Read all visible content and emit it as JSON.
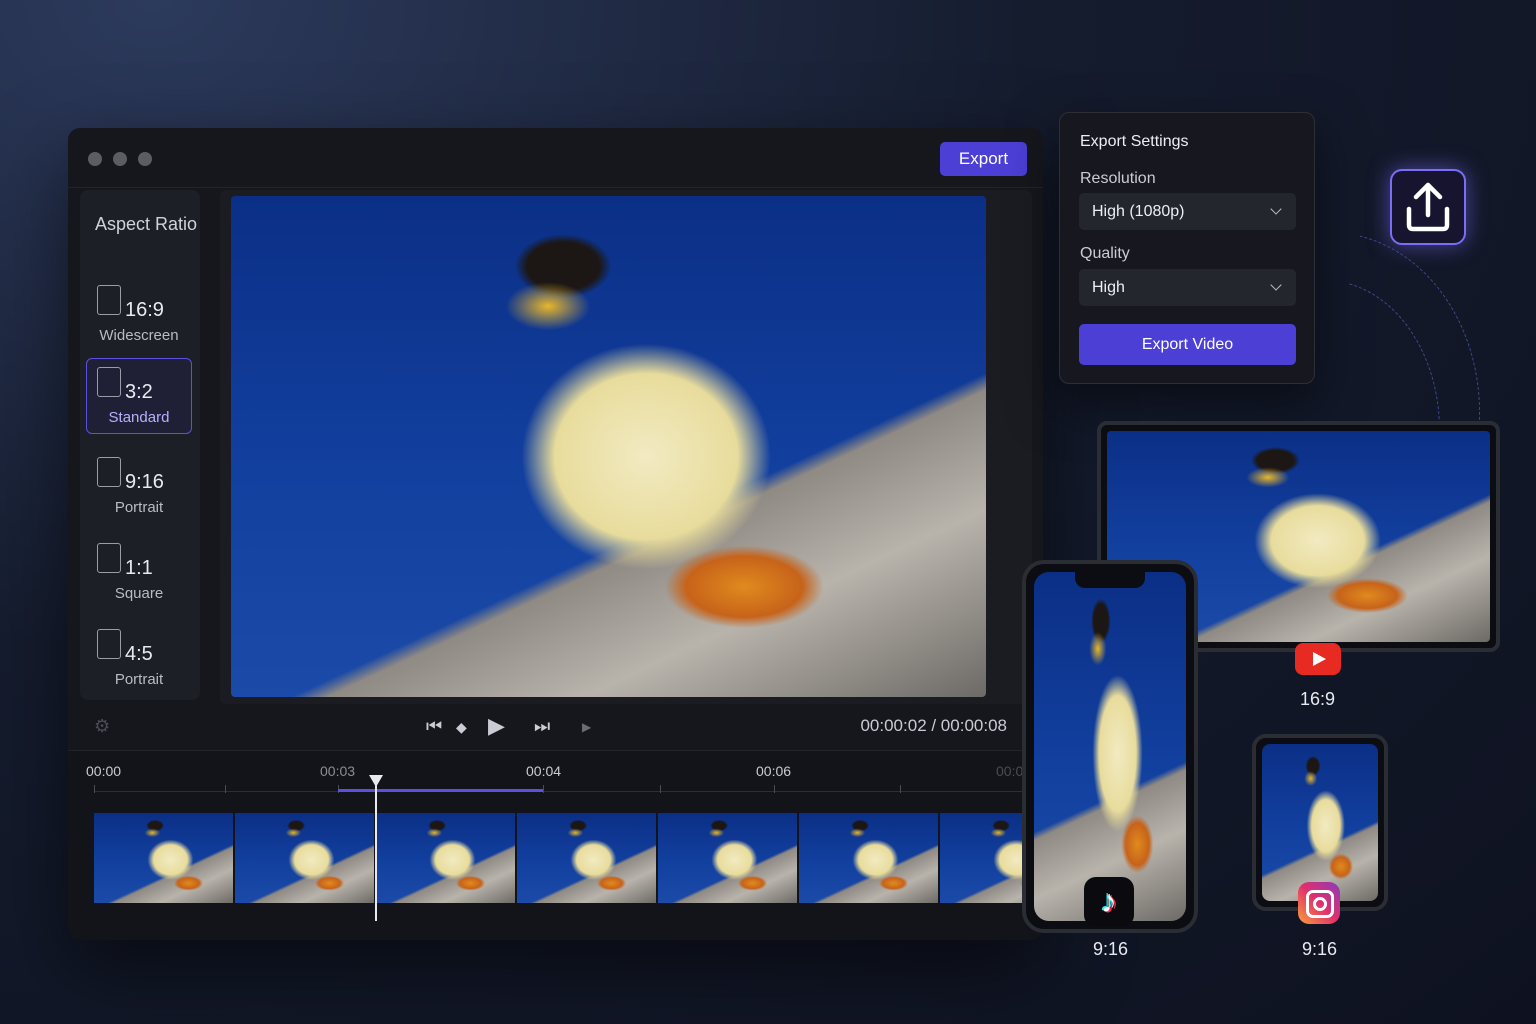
{
  "editor": {
    "export_label": "Export",
    "sidebar": {
      "title": "Aspect Ratio",
      "ratios": [
        {
          "value": "16:9",
          "label": "Widescreen"
        },
        {
          "value": "3:2",
          "label": "Standard",
          "selected": true
        },
        {
          "value": "9:16",
          "label": "Portrait"
        },
        {
          "value": "1:1",
          "label": "Square"
        },
        {
          "value": "4:5",
          "label": "Portrait"
        }
      ]
    },
    "timecode": "00:00:02 / 00:00:08",
    "timeline": {
      "ticks": [
        "00:00",
        "00:03",
        "00:04",
        "00:06",
        "00:0"
      ],
      "progress_fraction": 0.25
    }
  },
  "export_settings": {
    "title": "Export Settings",
    "resolution_label": "Resolution",
    "resolution_value": "High (1080p)",
    "quality_label": "Quality",
    "quality_value": "High",
    "export_video_label": "Export Video"
  },
  "devices": {
    "tablet_ratio": "16:9",
    "phone_ratio": "9:16",
    "small_phone_ratio": "9:16"
  },
  "icons": {
    "upload": "upload-icon",
    "youtube": "youtube-icon",
    "tiktok": "tiktok-icon",
    "instagram": "instagram-icon"
  },
  "colors": {
    "accent": "#4b3fd6",
    "upload_glow": "#7b6df5"
  }
}
